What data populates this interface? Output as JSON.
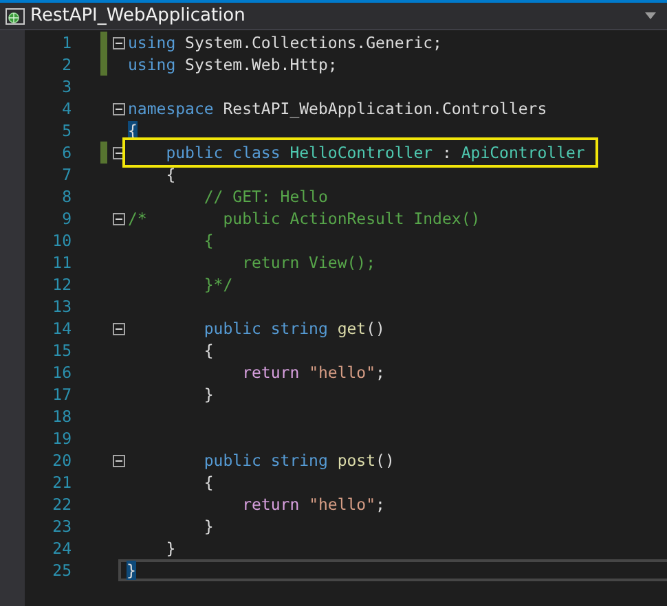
{
  "tab": {
    "title": "RestAPI_WebApplication"
  },
  "lines": [
    {
      "number": "1",
      "changed": true,
      "fold": true,
      "tokens": [
        {
          "kind": "keyword",
          "text": "using"
        },
        {
          "kind": "plain",
          "text": " System.Collections.Generic;"
        }
      ]
    },
    {
      "number": "2",
      "changed": true,
      "fold": false,
      "tokens": [
        {
          "kind": "keyword",
          "text": "using"
        },
        {
          "kind": "plain",
          "text": " System.Web.Http;"
        }
      ]
    },
    {
      "number": "3",
      "changed": false,
      "fold": false
    },
    {
      "number": "4",
      "changed": false,
      "fold": true,
      "tokens": [
        {
          "kind": "keyword",
          "text": "namespace"
        },
        {
          "kind": "plain",
          "text": " RestAPI_WebApplication.Controllers"
        }
      ]
    },
    {
      "number": "5",
      "changed": false,
      "fold": false,
      "tokens": [
        {
          "kind": "brace-match",
          "text": "{"
        }
      ]
    },
    {
      "number": "6",
      "changed": true,
      "fold": true,
      "annotated": true,
      "tokens": [
        {
          "kind": "keyword",
          "text": "    public class "
        },
        {
          "kind": "type",
          "text": "HelloController"
        },
        {
          "kind": "plain",
          "text": " : "
        },
        {
          "kind": "type",
          "text": "ApiController"
        }
      ]
    },
    {
      "number": "7",
      "changed": false,
      "fold": false,
      "tokens": [
        {
          "kind": "plain",
          "text": "    {"
        }
      ]
    },
    {
      "number": "8",
      "changed": false,
      "fold": false,
      "tokens": [
        {
          "kind": "comment",
          "text": "        // GET: Hello"
        }
      ]
    },
    {
      "number": "9",
      "changed": false,
      "fold": true,
      "tokens": [
        {
          "kind": "comment",
          "text": "/*        public ActionResult Index()"
        }
      ]
    },
    {
      "number": "10",
      "changed": false,
      "fold": false,
      "tokens": [
        {
          "kind": "comment",
          "text": "        {"
        }
      ]
    },
    {
      "number": "11",
      "changed": false,
      "fold": false,
      "tokens": [
        {
          "kind": "comment",
          "text": "            return View();"
        }
      ]
    },
    {
      "number": "12",
      "changed": false,
      "fold": false,
      "tokens": [
        {
          "kind": "comment",
          "text": "        }*/"
        }
      ]
    },
    {
      "number": "13",
      "changed": false,
      "fold": false
    },
    {
      "number": "14",
      "changed": false,
      "fold": true,
      "tokens": [
        {
          "kind": "keyword",
          "text": "        public string "
        },
        {
          "kind": "method",
          "text": "get"
        },
        {
          "kind": "plain",
          "text": "()"
        }
      ]
    },
    {
      "number": "15",
      "changed": false,
      "fold": false,
      "tokens": [
        {
          "kind": "plain",
          "text": "        {"
        }
      ]
    },
    {
      "number": "16",
      "changed": false,
      "fold": false,
      "tokens": [
        {
          "kind": "control",
          "text": "            return "
        },
        {
          "kind": "string",
          "text": "\"hello\""
        },
        {
          "kind": "plain",
          "text": ";"
        }
      ]
    },
    {
      "number": "17",
      "changed": false,
      "fold": false,
      "tokens": [
        {
          "kind": "plain",
          "text": "        }"
        }
      ]
    },
    {
      "number": "18",
      "changed": false,
      "fold": false
    },
    {
      "number": "19",
      "changed": false,
      "fold": false
    },
    {
      "number": "20",
      "changed": false,
      "fold": true,
      "tokens": [
        {
          "kind": "keyword",
          "text": "        public string "
        },
        {
          "kind": "method",
          "text": "post"
        },
        {
          "kind": "plain",
          "text": "()"
        }
      ]
    },
    {
      "number": "21",
      "changed": false,
      "fold": false,
      "tokens": [
        {
          "kind": "plain",
          "text": "        {"
        }
      ]
    },
    {
      "number": "22",
      "changed": false,
      "fold": false,
      "tokens": [
        {
          "kind": "control",
          "text": "            return "
        },
        {
          "kind": "string",
          "text": "\"hello\""
        },
        {
          "kind": "plain",
          "text": ";"
        }
      ]
    },
    {
      "number": "23",
      "changed": false,
      "fold": false,
      "tokens": [
        {
          "kind": "plain",
          "text": "        }"
        }
      ]
    },
    {
      "number": "24",
      "changed": false,
      "fold": false,
      "tokens": [
        {
          "kind": "plain",
          "text": "    }"
        }
      ]
    },
    {
      "number": "25",
      "changed": false,
      "fold": false,
      "current": true,
      "tokens": [
        {
          "kind": "brace-match",
          "text": "}"
        }
      ]
    }
  ]
}
